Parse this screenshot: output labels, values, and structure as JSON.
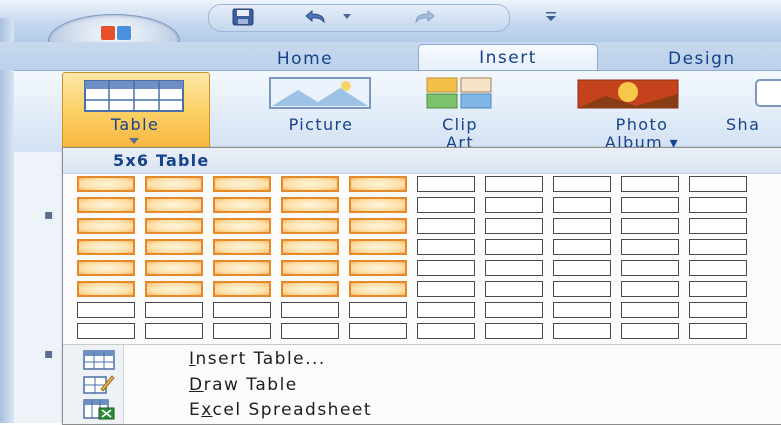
{
  "ribbon": {
    "tabs": [
      {
        "label": "Home"
      },
      {
        "label": "Insert"
      },
      {
        "label": "Design"
      }
    ],
    "buttons": {
      "table": {
        "label": "Table"
      },
      "picture": {
        "label": "Picture"
      },
      "clip_art": {
        "label_line1": "Clip",
        "label_line2": "Art"
      },
      "photo_album": {
        "label_line1": "Photo",
        "label_line2": "Album ▾"
      },
      "shapes": {
        "label": "Sha"
      }
    }
  },
  "quick_access": {
    "icons": [
      "save-icon",
      "undo-icon",
      "redo-icon",
      "customize-icon"
    ]
  },
  "table_dropdown": {
    "title": "5x6 Table",
    "grid": {
      "columns": 10,
      "rows": 8,
      "selected_columns": 5,
      "selected_rows": 6
    },
    "menu_items": [
      {
        "accel": "I",
        "rest": "nsert Table...",
        "icon": "insert-table-icon"
      },
      {
        "accel": "D",
        "rest": "raw Table",
        "icon": "draw-table-icon"
      },
      {
        "pre": "E",
        "accel": "x",
        "rest": "cel Spreadsheet",
        "icon": "excel-spreadsheet-icon"
      }
    ]
  },
  "colors": {
    "accent_text": "#15428b",
    "selection_border": "#e48a2a",
    "ribbon_bg": "#dbe7f6"
  }
}
